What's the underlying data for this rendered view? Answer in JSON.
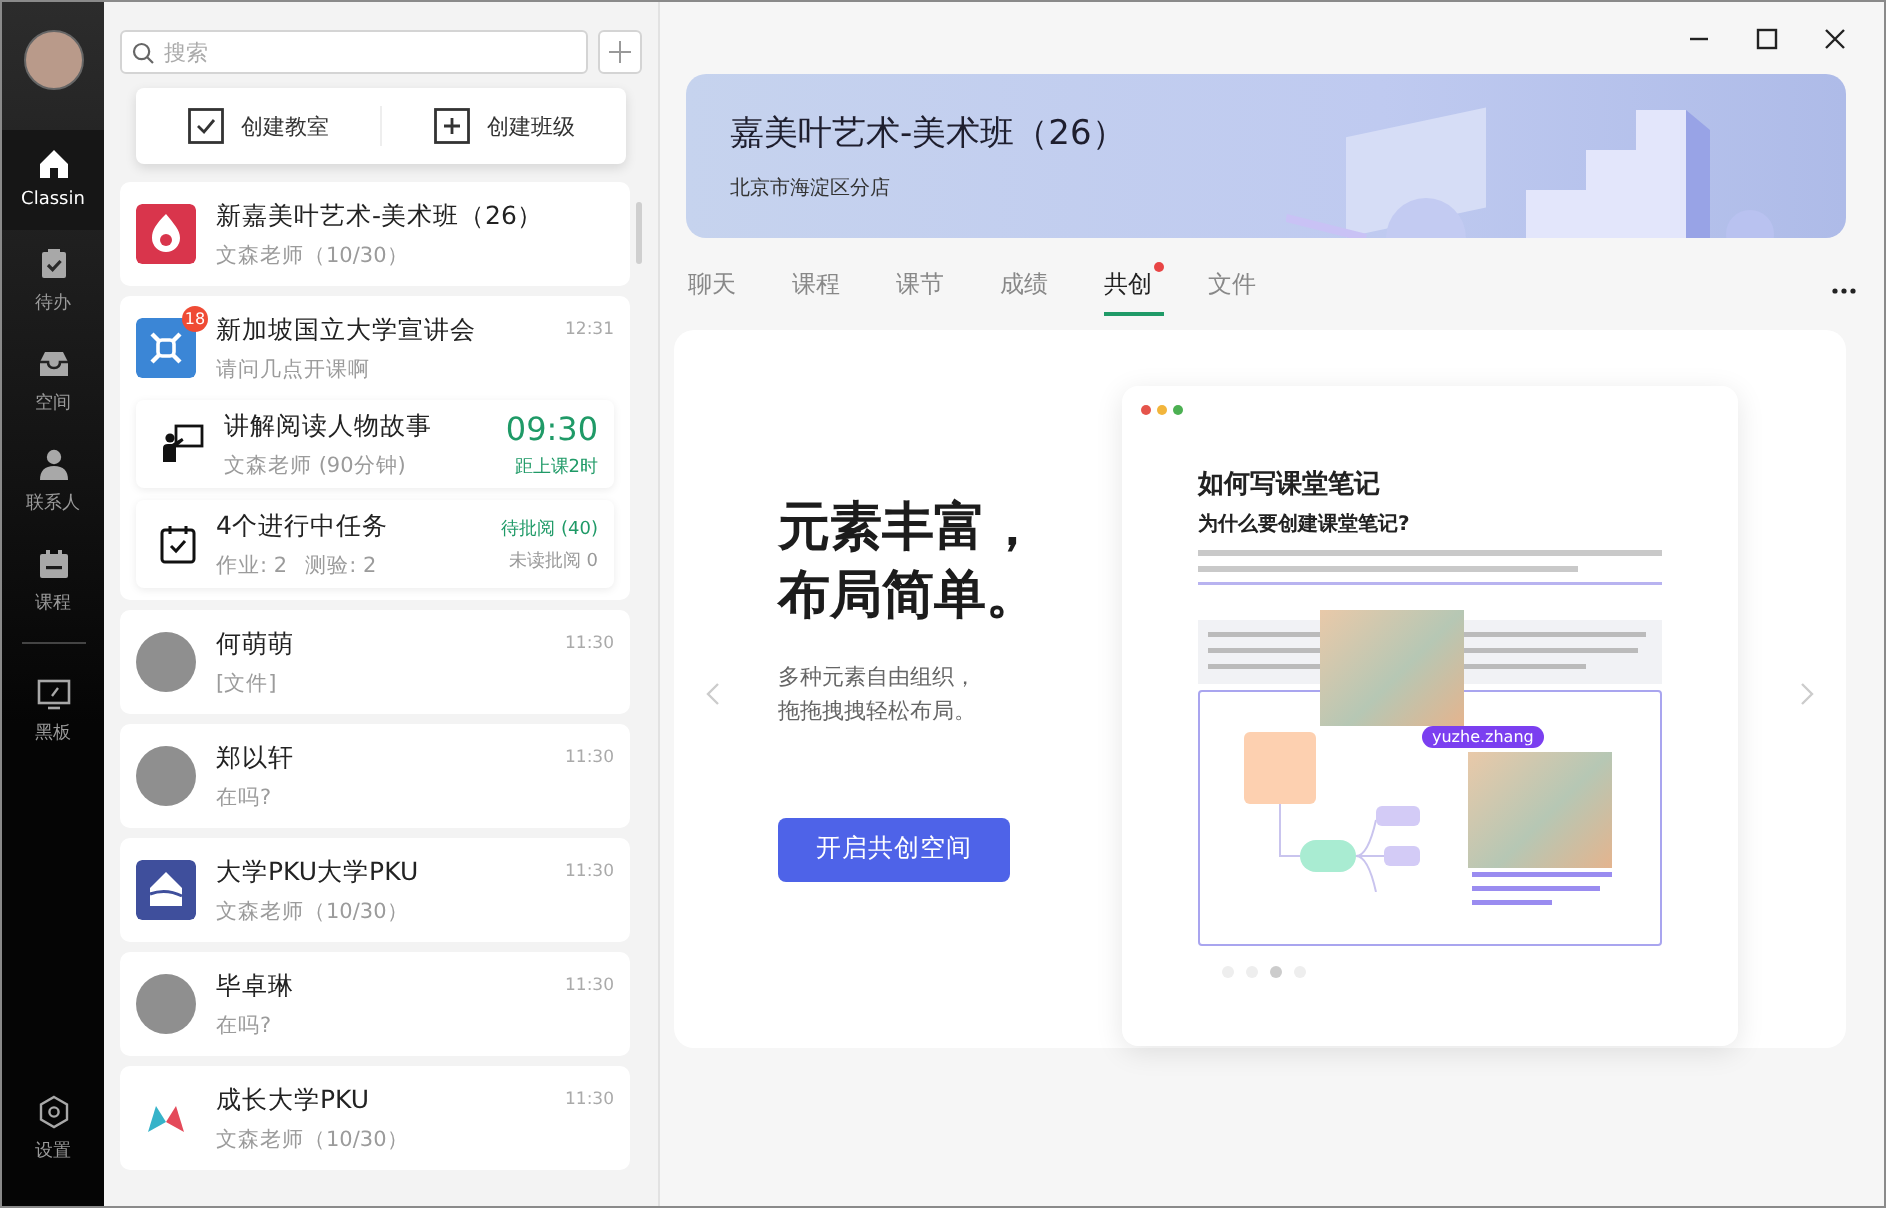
{
  "nav": [
    {
      "label": "Classin",
      "kind": "home",
      "selected": true
    },
    {
      "label": "待办",
      "kind": "todo",
      "selected": false
    },
    {
      "label": "空间",
      "kind": "space",
      "selected": false
    },
    {
      "label": "联系人",
      "kind": "contacts",
      "selected": false
    },
    {
      "label": "课程",
      "kind": "course",
      "selected": false
    }
  ],
  "tools": [
    {
      "label": "黑板",
      "kind": "board",
      "selected": false
    }
  ],
  "settings": {
    "label": "设置"
  },
  "search": {
    "placeholder": "搜索"
  },
  "quick_actions": [
    {
      "label": "创建教室",
      "kind": "check"
    },
    {
      "label": "创建班级",
      "kind": "plus"
    }
  ],
  "conversations": [
    {
      "kind": "logo",
      "color": "#d9354c",
      "title": "新嘉美叶艺术-美术班（26）",
      "subtitle": "文森老师（10/30）"
    },
    {
      "kind": "logo",
      "color": "#3b86d6",
      "badge": "18",
      "title": "新加坡国立大学宣讲会",
      "time": "12:31",
      "subtitle": "请问几点开课啊",
      "cards": [
        {
          "kind": "lesson",
          "title": "讲解阅读人物故事",
          "subtitle": "文森老师 (90分钟)",
          "time": "09:30",
          "note": "距上课2时"
        },
        {
          "kind": "tasks",
          "title": "4个进行中任务",
          "details": [
            "作业: 2",
            "测验: 2"
          ],
          "status": "待批阅 (40)",
          "note": "未读批阅 0"
        }
      ]
    },
    {
      "kind": "person",
      "title": "何萌萌",
      "time": "11:30",
      "subtitle": "[文件]"
    },
    {
      "kind": "person",
      "title": "郑以轩",
      "time": "11:30",
      "subtitle": "在吗?"
    },
    {
      "kind": "logo",
      "color": "#3f4f9c",
      "title": "大学PKU大学PKU",
      "time": "11:30",
      "subtitle": "文森老师（10/30）"
    },
    {
      "kind": "person",
      "title": "毕卓琳",
      "time": "11:30",
      "subtitle": "在吗?"
    },
    {
      "kind": "logo",
      "color": "#ffffff",
      "title": "成长大学PKU",
      "time": "11:30",
      "subtitle": "文森老师（10/30）"
    }
  ],
  "header": {
    "title": "嘉美叶艺术-美术班（26）",
    "subtitle": "北京市海淀区分店"
  },
  "tabs": [
    {
      "label": "聊天",
      "selected": false,
      "dot": false
    },
    {
      "label": "课程",
      "selected": false,
      "dot": false
    },
    {
      "label": "课节",
      "selected": false,
      "dot": false
    },
    {
      "label": "成绩",
      "selected": false,
      "dot": false
    },
    {
      "label": "共创",
      "selected": true,
      "dot": true
    },
    {
      "label": "文件",
      "selected": false,
      "dot": false
    }
  ],
  "promo": {
    "headline": [
      "元素丰富，",
      "布局简单。"
    ],
    "description": [
      "多种元素自由组织，",
      "拖拖拽拽轻松布局。"
    ],
    "button": "开启共创空间",
    "preview": {
      "title": "如何写课堂笔记",
      "heading": "为什么要创建课堂笔记?",
      "user_tag": "yuzhe.zhang",
      "pages": [
        {
          "selected": false
        },
        {
          "selected": false
        },
        {
          "selected": true
        },
        {
          "selected": false
        }
      ]
    }
  }
}
